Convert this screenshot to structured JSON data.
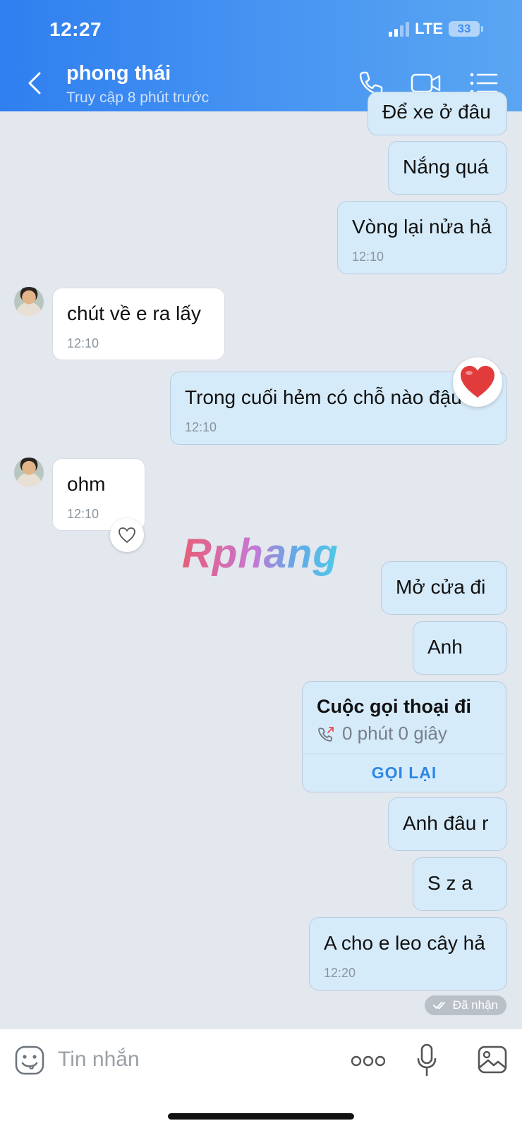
{
  "status_bar": {
    "time": "12:27",
    "network": "LTE",
    "battery": "33"
  },
  "header": {
    "contact_name": "phong thái",
    "contact_status": "Truy cập 8 phút trước",
    "icons": [
      "back-chevron-icon",
      "phone-icon",
      "video-camera-icon",
      "list-menu-icon"
    ]
  },
  "messages": [
    {
      "direction": "out",
      "text": "Để xe ở đâu"
    },
    {
      "direction": "out",
      "text": "Nắng quá"
    },
    {
      "direction": "out",
      "text": "Vòng lại nửa hả",
      "time": "12:10"
    },
    {
      "direction": "in",
      "text": "chút về e ra lấy",
      "time": "12:10"
    },
    {
      "direction": "out",
      "text": "Trong cuối hẻm có chỗ nào đậu k",
      "time": "12:10",
      "reaction": "heart"
    },
    {
      "direction": "in",
      "text": "ohm",
      "time": "12:10"
    },
    {
      "direction": "out",
      "text": "Mở cửa đi"
    },
    {
      "direction": "out",
      "text": "Anh"
    },
    {
      "direction": "out",
      "text": "Anh đâu r"
    },
    {
      "direction": "out",
      "text": "S z a"
    },
    {
      "direction": "out",
      "text": "A cho e leo cây hả",
      "time": "12:20"
    }
  ],
  "call_card": {
    "title": "Cuộc gọi thoại đi",
    "duration": "0 phút 0 giây",
    "action": "GỌI LẠI"
  },
  "watermark": "Rphang",
  "delivery_status": "Đã nhận",
  "composer": {
    "placeholder": "Tin nhắn",
    "icons": [
      "sticker-icon",
      "more-icon",
      "microphone-icon",
      "image-icon"
    ]
  },
  "colors": {
    "header_start": "#2f7ff0",
    "header_end": "#5aa6f2",
    "outgoing_bubble": "#d6ebfa",
    "incoming_bubble": "#ffffff",
    "chat_background": "#e3e7ee",
    "accent": "#2f86e6"
  }
}
